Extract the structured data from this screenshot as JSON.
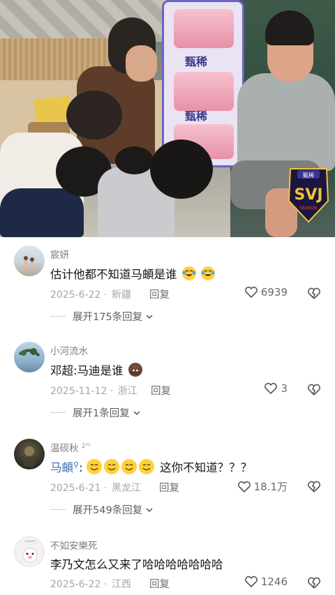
{
  "video": {
    "banner_brand": "甄稀",
    "badge_brand": "甄稀",
    "badge_season": "SEASON",
    "badge_title": "SVJ"
  },
  "comments": [
    {
      "username": "宸妍",
      "text": "估计他都不知道马頔是谁",
      "emoji": [
        "crying-laughing-emoji",
        "crying-laughing-emoji"
      ],
      "date": "2025-6-22",
      "location": "新疆",
      "reply_label": "回复",
      "likes": "6939",
      "expand_label": "展开175条回复"
    },
    {
      "username": "小河流水",
      "text": "邓超:马迪是谁",
      "emoji": [
        "poop-emoji"
      ],
      "date": "2025-11-12",
      "location": "浙江",
      "reply_label": "回复",
      "likes": "3",
      "expand_label": "展开1条回复"
    },
    {
      "username": "温砚秋",
      "username_badge": "2¹¹",
      "mention": "马頔",
      "text_after": "这你不知道？？？",
      "emoji": [
        "smile-emoji",
        "smile-emoji",
        "smile-emoji",
        "smile-emoji"
      ],
      "date": "2025-6-21",
      "location": "黑龙江",
      "reply_label": "回复",
      "likes": "18.1万",
      "expand_label": "展开549条回复"
    },
    {
      "username": "不如安樂死",
      "text": "李乃文怎么又来了哈哈哈哈哈哈哈",
      "date": "2025-6-22",
      "location": "江西",
      "reply_label": "回复",
      "likes": "1246"
    }
  ],
  "colors": {
    "username": "#7d7d7d",
    "meta": "#a6a6a6",
    "mention": "#3f6fb5",
    "background": "#ffffff"
  }
}
